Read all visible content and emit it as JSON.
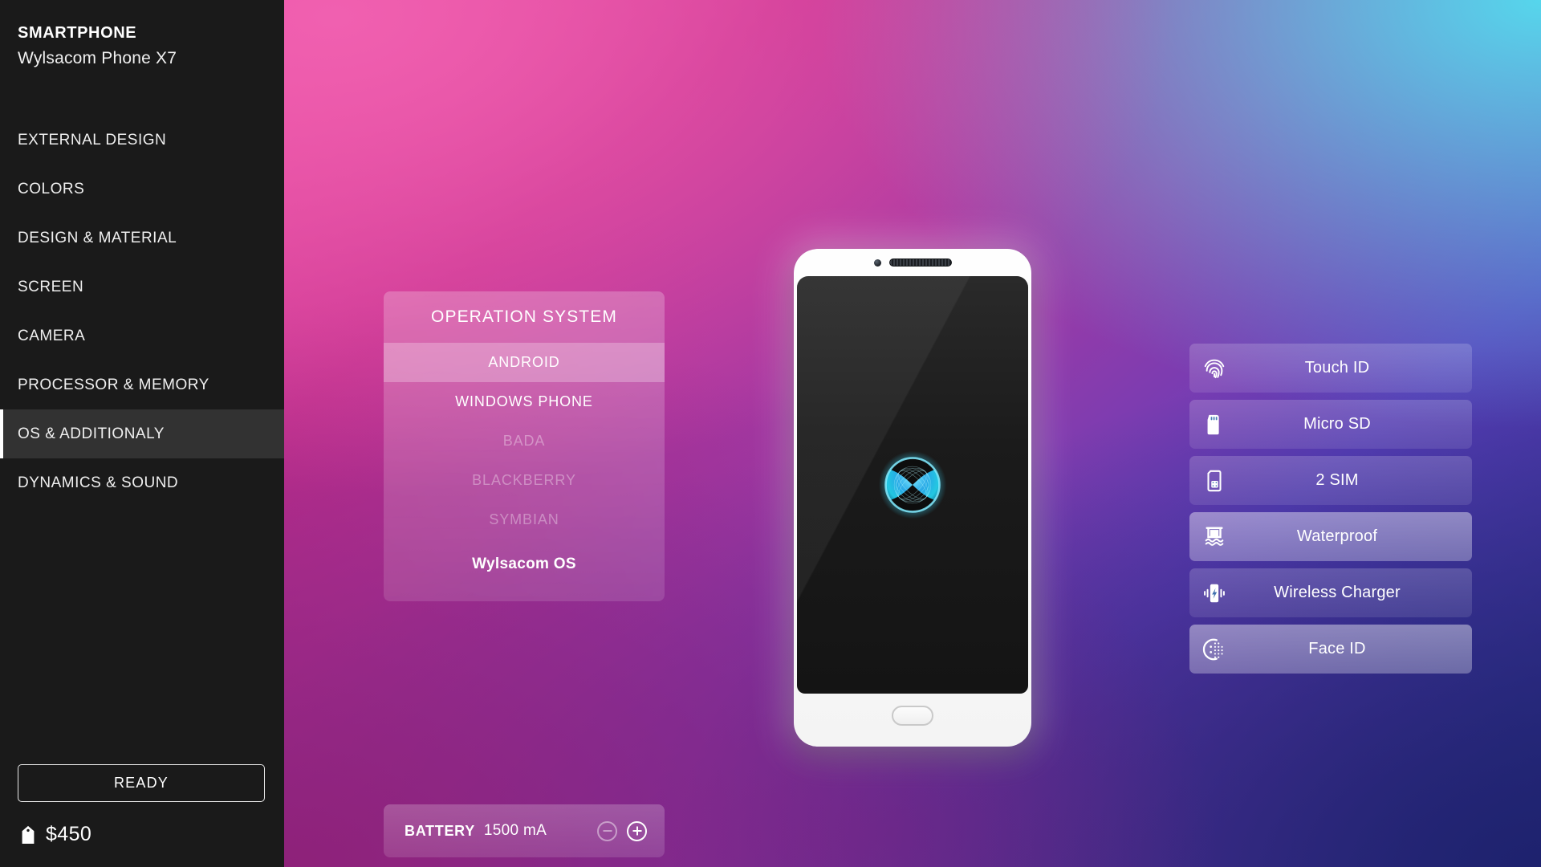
{
  "sidebar": {
    "brand_title": "SMARTPHONE",
    "brand_subtitle": "Wylsacom Phone X7",
    "items": [
      {
        "label": "EXTERNAL DESIGN",
        "active": false
      },
      {
        "label": "COLORS",
        "active": false
      },
      {
        "label": "DESIGN & MATERIAL",
        "active": false
      },
      {
        "label": "SCREEN",
        "active": false
      },
      {
        "label": "CAMERA",
        "active": false
      },
      {
        "label": "PROCESSOR & MEMORY",
        "active": false
      },
      {
        "label": "OS & ADDITIONALY",
        "active": true
      },
      {
        "label": "DYNAMICS & SOUND",
        "active": false
      }
    ],
    "ready_label": "READY",
    "price": "$450",
    "price_icon": "price-tag-icon"
  },
  "os_panel": {
    "title": "OPERATION SYSTEM",
    "options": [
      {
        "label": "ANDROID",
        "state": "selected"
      },
      {
        "label": "WINDOWS PHONE",
        "state": "available"
      },
      {
        "label": "BADA",
        "state": "disabled"
      },
      {
        "label": "BLACKBERRY",
        "state": "disabled"
      },
      {
        "label": "SYMBIAN",
        "state": "disabled"
      },
      {
        "label": "Wylsacom OS",
        "state": "brand"
      }
    ]
  },
  "battery": {
    "label": "BATTERY",
    "value": "1500 mA",
    "decrease_label": "−",
    "increase_label": "+"
  },
  "features": [
    {
      "label": "Touch ID",
      "icon": "fingerprint-icon",
      "on": false
    },
    {
      "label": "Micro SD",
      "icon": "sd-card-icon",
      "on": false
    },
    {
      "label": "2 SIM",
      "icon": "sim-card-icon",
      "on": false
    },
    {
      "label": "Waterproof",
      "icon": "waterproof-icon",
      "on": true
    },
    {
      "label": "Wireless Charger",
      "icon": "wireless-charger-icon",
      "on": false
    },
    {
      "label": "Face ID",
      "icon": "face-id-icon",
      "on": true
    }
  ],
  "phone": {
    "camera_icon": "front-camera-icon",
    "speaker_icon": "earpiece-speaker-icon",
    "wallpaper_logo": "wylsacom-orb-logo",
    "home_button_label": "home-button"
  },
  "colors": {
    "sidebar_bg": "#1a1a1a",
    "sidebar_active_bg": "#323232",
    "accent_pink": "#e9479c",
    "accent_cyan": "#56d6ec",
    "accent_purple": "#6e2f9e",
    "accent_navy": "#1e226e",
    "text_on_dark": "#ffffff"
  }
}
